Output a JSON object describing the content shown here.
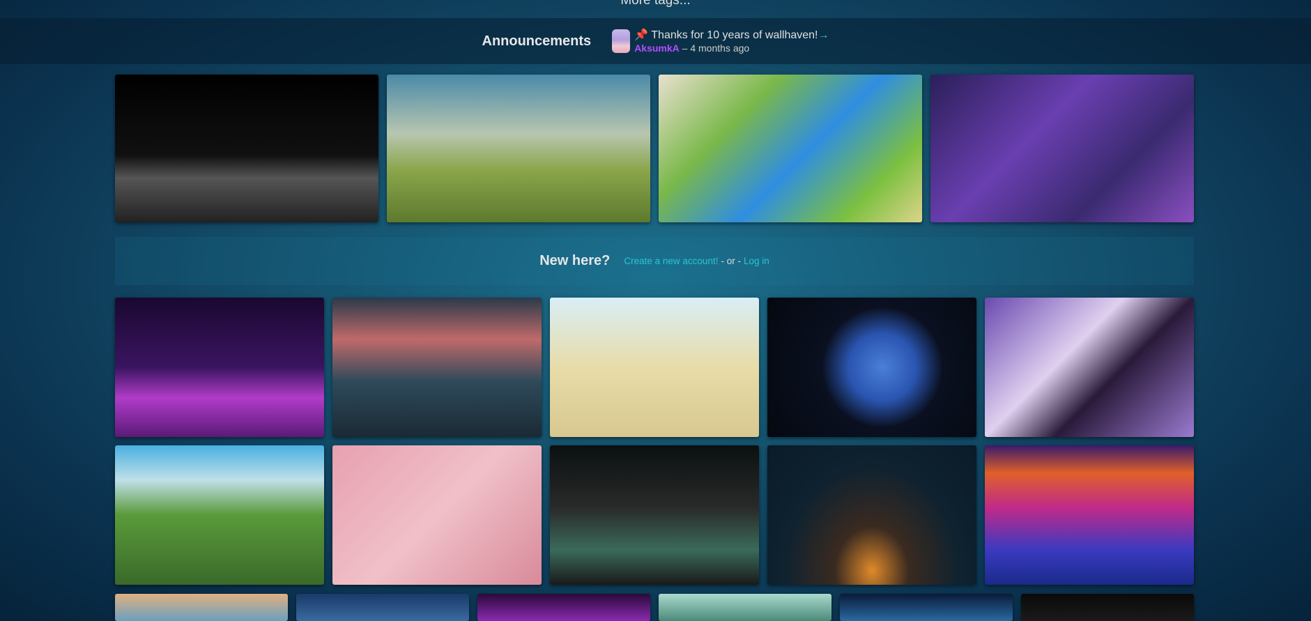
{
  "more_tags": "More tags...",
  "announcements": {
    "title": "Announcements",
    "pin_icon": "pushpin",
    "text": "Thanks for 10 years of wallhaven!",
    "arrow": "→",
    "user": "AksumkA",
    "time": "– 4 months ago"
  },
  "new_here": {
    "title": "New here?",
    "create": "Create a new account!",
    "or": "- or -",
    "login": "Log in"
  },
  "featured": [
    {
      "bg": "linear-gradient(180deg,#000 0%,#111 55%,#555 70%,#222 100%)"
    },
    {
      "bg": "linear-gradient(180deg,#4a8aa8 0%,#b8c6b0 40%,#8aa54a 65%,#5d7a2e 100%)"
    },
    {
      "bg": "linear-gradient(135deg,#e8e0cf 0%,#7ab84a 30%,#2f8ee0 55%,#7cc040 80%,#dcd48a 100%)"
    },
    {
      "bg": "linear-gradient(135deg,#2b1f5a 0%,#6a3fb0 40%,#3a2a70 70%,#8a4fc0 100%)"
    }
  ],
  "grid_rows": [
    [
      {
        "bg": "linear-gradient(180deg,#1a0830 0%,#3a1460 50%,#b03cc8 72%,#5a1a78 100%)"
      },
      {
        "bg": "linear-gradient(180deg,#2a3a4a 0%,#c06a6a 30%,#2f4a5a 60%,#1a2a35 100%)"
      },
      {
        "bg": "linear-gradient(180deg,#d8eef6 0%,#e8dca8 50%,#d8c890 100%)"
      },
      {
        "bg": "radial-gradient(circle at 55% 50%,#4a7fd8 0%,#2a55b0 25%,#0a1020 45%,#050810 100%)"
      },
      {
        "bg": "linear-gradient(135deg,#6a4ab0 0%,#e0d0f0 40%,#2a1a3a 60%,#9a7ad0 100%)"
      }
    ],
    [
      {
        "bg": "linear-gradient(180deg,#4ab0e0 0%,#bfe0e8 25%,#5a9a3a 50%,#3a6a2a 100%)"
      },
      {
        "bg": "linear-gradient(135deg,#e8a0b0 0%,#f0c0c8 50%,#d88a9a 100%)"
      },
      {
        "bg": "linear-gradient(180deg,#0a1010 0%,#2a2a2a 45%,#3a6a5a 75%,#1a1a1a 100%)"
      },
      {
        "bg": "radial-gradient(ellipse at 50% 90%,#e08a2a 0%,#3a2a20 25%,#0e2230 60%,#0a1a28 100%)"
      },
      {
        "bg": "linear-gradient(180deg,#3a1a6a 0%,#e0602a 20%,#c02a8a 45%,#3a3ac0 75%,#1a2a8a 100%)"
      }
    ],
    [
      {
        "bg": "linear-gradient(180deg,#e0b080 0%,#6aa0c0 100%)"
      },
      {
        "bg": "linear-gradient(180deg,#1a3a6a 0%,#3a6aa0 100%)"
      },
      {
        "bg": "linear-gradient(180deg,#2a0a3a 0%,#8a2ab0 100%)"
      },
      {
        "bg": "linear-gradient(180deg,#aadacc 0%,#4a8a7a 100%)"
      },
      {
        "bg": "linear-gradient(180deg,#0a1a3a 0%,#2a6aa0 100%)"
      },
      {
        "bg": "linear-gradient(180deg,#0a0a0a 0%,#1a1a1a 100%)"
      }
    ]
  ]
}
